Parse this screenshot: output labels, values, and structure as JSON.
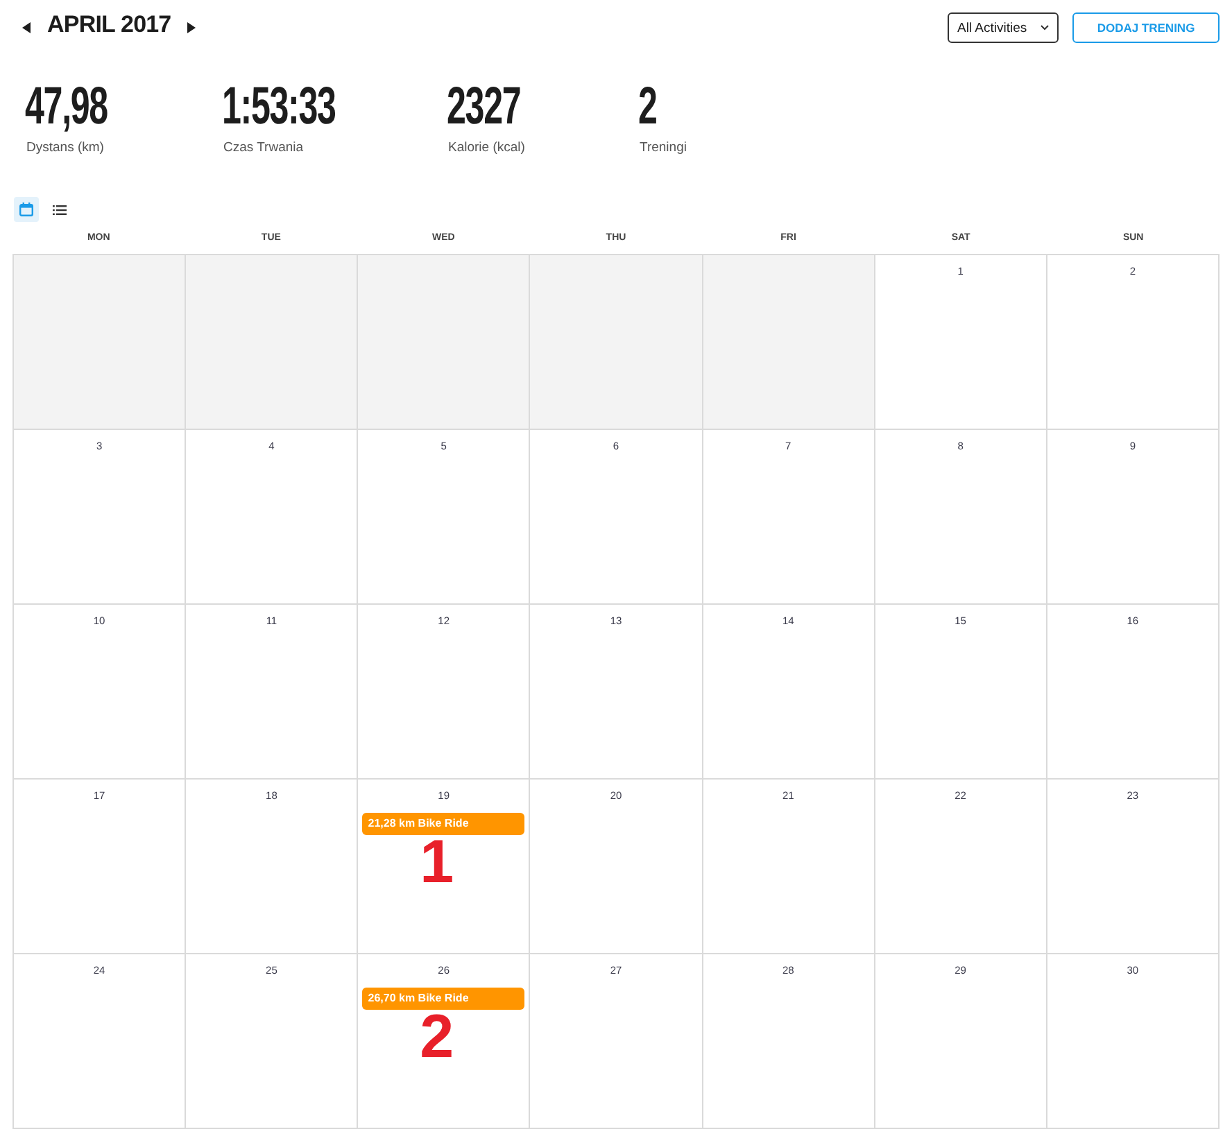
{
  "header": {
    "title": "APRIL 2017",
    "filter": {
      "value": "All Activities"
    },
    "add_button": {
      "label": "DODAJ TRENING"
    }
  },
  "stats": [
    {
      "value": "47,98",
      "label": "Dystans (km)"
    },
    {
      "value": "1:53:33",
      "label": "Czas Trwania"
    },
    {
      "value": "2327",
      "label": "Kalorie (kcal)"
    },
    {
      "value": "2",
      "label": "Treningi"
    }
  ],
  "view_toggle": [
    {
      "kind": "calendar",
      "selected": true
    },
    {
      "kind": "list",
      "selected": false
    }
  ],
  "weekdays": [
    "MON",
    "TUE",
    "WED",
    "THU",
    "FRI",
    "SAT",
    "SUN"
  ],
  "weeks": [
    [
      {
        "in_month": false
      },
      {
        "in_month": false
      },
      {
        "in_month": false
      },
      {
        "in_month": false
      },
      {
        "in_month": false
      },
      {
        "day": "1",
        "in_month": true
      },
      {
        "day": "2",
        "in_month": true
      }
    ],
    [
      {
        "day": "3",
        "in_month": true
      },
      {
        "day": "4",
        "in_month": true
      },
      {
        "day": "5",
        "in_month": true
      },
      {
        "day": "6",
        "in_month": true
      },
      {
        "day": "7",
        "in_month": true
      },
      {
        "day": "8",
        "in_month": true
      },
      {
        "day": "9",
        "in_month": true
      }
    ],
    [
      {
        "day": "10",
        "in_month": true
      },
      {
        "day": "11",
        "in_month": true
      },
      {
        "day": "12",
        "in_month": true
      },
      {
        "day": "13",
        "in_month": true
      },
      {
        "day": "14",
        "in_month": true
      },
      {
        "day": "15",
        "in_month": true
      },
      {
        "day": "16",
        "in_month": true
      }
    ],
    [
      {
        "day": "17",
        "in_month": true
      },
      {
        "day": "18",
        "in_month": true
      },
      {
        "day": "19",
        "in_month": true,
        "events": [
          {
            "label": "21,28 km Bike Ride",
            "annotation": "1"
          }
        ]
      },
      {
        "day": "20",
        "in_month": true
      },
      {
        "day": "21",
        "in_month": true
      },
      {
        "day": "22",
        "in_month": true
      },
      {
        "day": "23",
        "in_month": true
      }
    ],
    [
      {
        "day": "24",
        "in_month": true
      },
      {
        "day": "25",
        "in_month": true
      },
      {
        "day": "26",
        "in_month": true,
        "events": [
          {
            "label": "26,70 km Bike Ride",
            "annotation": "2"
          }
        ]
      },
      {
        "day": "27",
        "in_month": true
      },
      {
        "day": "28",
        "in_month": true
      },
      {
        "day": "29",
        "in_month": true
      },
      {
        "day": "30",
        "in_month": true
      }
    ]
  ]
}
